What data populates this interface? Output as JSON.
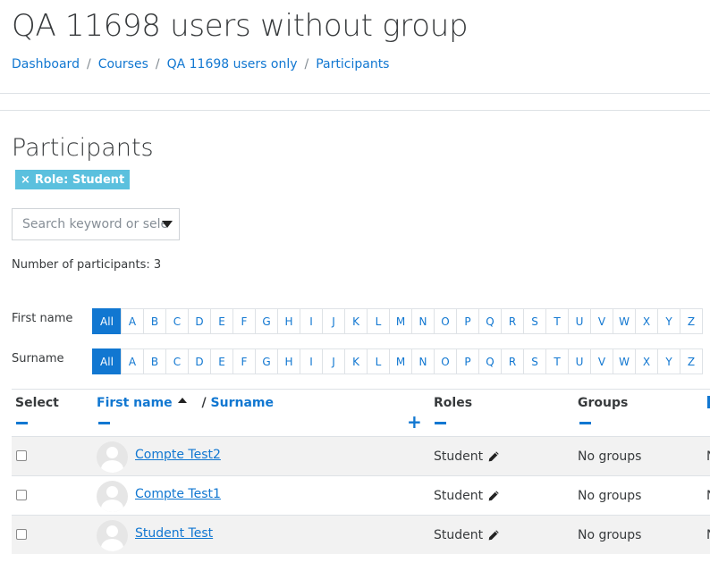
{
  "course": {
    "title": "QA 11698 users without group"
  },
  "breadcrumb": [
    {
      "label": "Dashboard"
    },
    {
      "label": "Courses"
    },
    {
      "label": "QA 11698 users only"
    },
    {
      "label": "Participants"
    }
  ],
  "section_title": "Participants",
  "filter": {
    "remove_symbol": "×",
    "label": "Role: Student",
    "color": "#5bc0de"
  },
  "search": {
    "placeholder": "Search keyword or select filter"
  },
  "participant_count": "Number of participants: 3",
  "initials": {
    "firstname_label": "First name",
    "surname_label": "Surname",
    "all_label": "All",
    "letters": [
      "A",
      "B",
      "C",
      "D",
      "E",
      "F",
      "G",
      "H",
      "I",
      "J",
      "K",
      "L",
      "M",
      "N",
      "O",
      "P",
      "Q",
      "R",
      "S",
      "T",
      "U",
      "V",
      "W",
      "X",
      "Y",
      "Z"
    ]
  },
  "table": {
    "headers": {
      "select": "Select",
      "firstname": "First name",
      "separator": "/",
      "surname": "Surname",
      "roles": "Roles",
      "groups": "Groups"
    },
    "rows": [
      {
        "name": "Compte Test2",
        "role": "Student",
        "groups": "No groups",
        "clipped": "N"
      },
      {
        "name": "Compte Test1",
        "role": "Student",
        "groups": "No groups",
        "clipped": "N"
      },
      {
        "name": "Student Test",
        "role": "Student",
        "groups": "No groups",
        "clipped": "N"
      }
    ]
  },
  "colors": {
    "link": "#1177d1",
    "badge": "#5bc0de",
    "text": "#373a3c"
  }
}
